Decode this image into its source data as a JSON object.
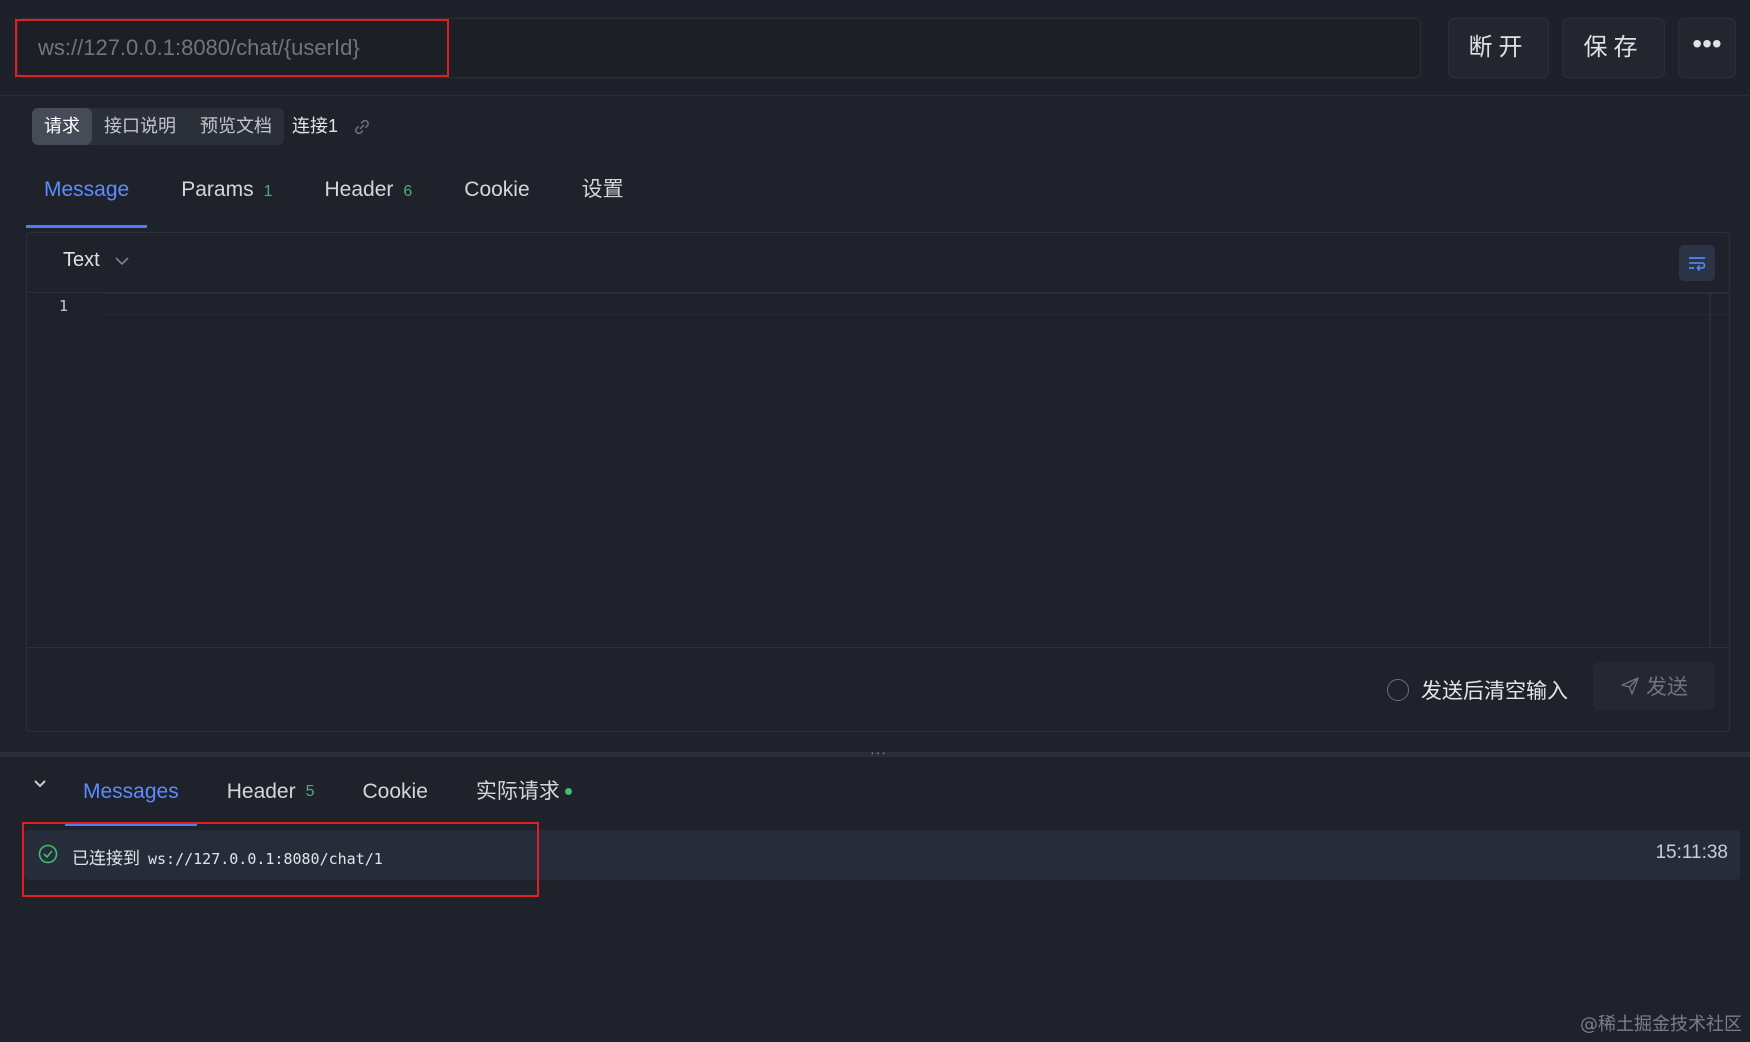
{
  "url_bar": {
    "placeholder": "ws://127.0.0.1:8080/chat/{userId}",
    "value": ""
  },
  "toolbar": {
    "disconnect_label": "断开",
    "save_label": "保存",
    "more_label": "•••"
  },
  "subtabs": {
    "items": [
      "请求",
      "接口说明",
      "预览文档"
    ],
    "active_index": 0,
    "connection_name": "连接1"
  },
  "request_tabs": [
    {
      "label": "Message",
      "count": ""
    },
    {
      "label": "Params",
      "count": "1"
    },
    {
      "label": "Header",
      "count": "6"
    },
    {
      "label": "Cookie",
      "count": ""
    },
    {
      "label": "设置",
      "count": ""
    }
  ],
  "editor": {
    "format": "Text",
    "line_numbers": [
      "1"
    ],
    "content": ""
  },
  "send_area": {
    "clear_after_send_label": "发送后清空输入",
    "send_label": "发送"
  },
  "splitter": {
    "dots": "···"
  },
  "response_tabs": [
    {
      "label": "Messages",
      "count": ""
    },
    {
      "label": "Header",
      "count": "5"
    },
    {
      "label": "Cookie",
      "count": ""
    },
    {
      "label": "实际请求",
      "count": ""
    }
  ],
  "messages": [
    {
      "prefix": "已连接到",
      "url": "ws://127.0.0.1:8080/chat/1",
      "time": "15:11:38",
      "status": "connected"
    }
  ],
  "watermark": "@稀土掘金技术社区",
  "colors": {
    "accent": "#5b8cff",
    "success": "#3fbf6e",
    "highlight_box": "#e02020",
    "background": "#1f222a"
  }
}
